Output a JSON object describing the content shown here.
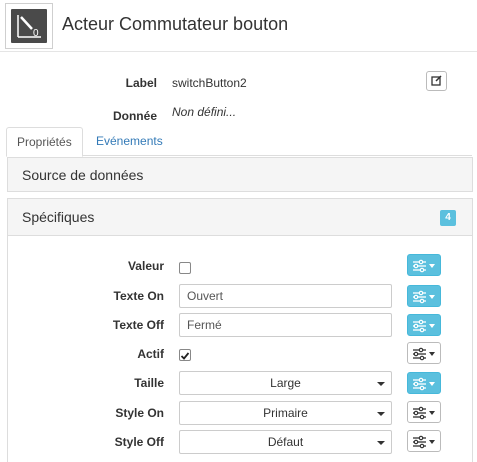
{
  "header": {
    "title": "Acteur Commutateur bouton",
    "logo_text": "0"
  },
  "props": {
    "label_label": "Label",
    "label_value": "switchButton2",
    "data_label": "Donnée",
    "data_value": "Non défini..."
  },
  "tabs": {
    "properties": "Propriétés",
    "events": "Evénements"
  },
  "panels": {
    "data_source": "Source de données",
    "specifics": "Spécifiques",
    "specifics_badge": "4"
  },
  "fields": {
    "value_label": "Valeur",
    "value_checked": false,
    "text_on_label": "Texte On",
    "text_on_value": "Ouvert",
    "text_off_label": "Texte Off",
    "text_off_value": "Fermé",
    "active_label": "Actif",
    "active_checked": true,
    "size_label": "Taille",
    "size_value": "Large",
    "style_on_label": "Style On",
    "style_on_value": "Primaire",
    "style_off_label": "Style Off",
    "style_off_value": "Défaut"
  },
  "colors": {
    "accent": "#5bc0de",
    "link": "#337ab7"
  },
  "icons": {
    "edit": "edit-icon",
    "options": "sliders-icon",
    "caret": "caret-down-icon"
  }
}
